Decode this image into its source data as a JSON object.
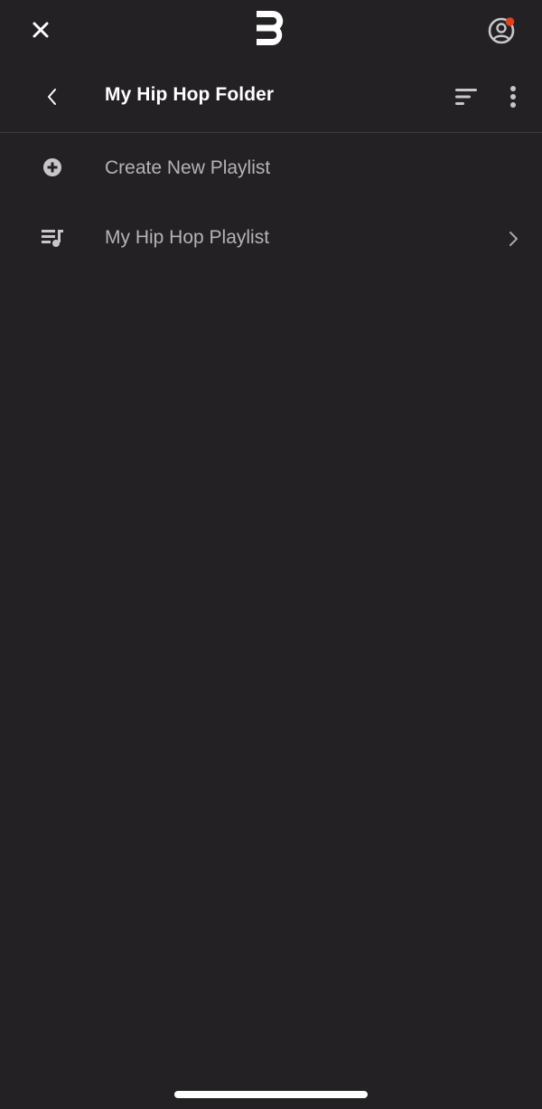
{
  "topbar": {
    "close_icon": "close-icon",
    "logo_icon": "brand-logo-icon",
    "profile_icon": "user-profile-icon",
    "notification_dot_color": "#e0401f"
  },
  "header": {
    "back_icon": "chevron-left-icon",
    "title": "My Hip Hop Folder",
    "sort_icon": "sort-icon",
    "more_icon": "more-vertical-icon"
  },
  "list": {
    "items": [
      {
        "label": "Create New Playlist",
        "icon": "plus-circle-icon",
        "has_chevron": false
      },
      {
        "label": "My Hip Hop Playlist",
        "icon": "playlist-music-icon",
        "has_chevron": true
      }
    ]
  },
  "colors": {
    "background": "#232124",
    "title_text": "#ffffff",
    "row_text": "#b5b3b6",
    "icon": "#c8c6c9",
    "divider": "#3d3b3f"
  }
}
